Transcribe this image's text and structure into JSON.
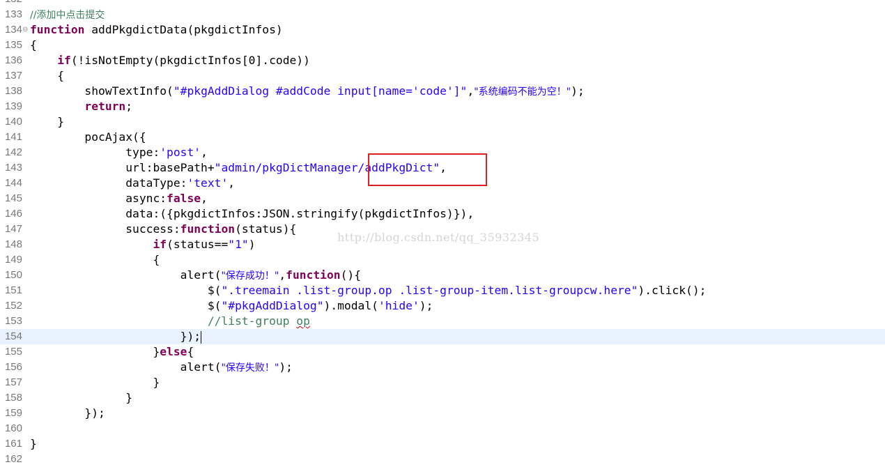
{
  "editor": {
    "watermark": "http://blog.csdn.net/qq_35932345",
    "colors": {
      "keyword": "#7f0055",
      "string": "#2a00ff",
      "comment": "#3f7f5f",
      "highlight": "#e02020",
      "current_line": "#e8f2fe"
    },
    "lines": [
      {
        "n": "132",
        "tokens": []
      },
      {
        "n": "133",
        "tokens": [
          {
            "t": "//添加中点击提交",
            "c": "cm"
          }
        ]
      },
      {
        "n": "134",
        "fold": true,
        "tokens": [
          {
            "t": "function",
            "c": "kw"
          },
          {
            "t": " addPkgdictData(pkgdictInfos)"
          }
        ]
      },
      {
        "n": "135",
        "tokens": [
          {
            "t": "{"
          }
        ]
      },
      {
        "n": "136",
        "tokens": [
          {
            "t": "    "
          },
          {
            "t": "if",
            "c": "kw"
          },
          {
            "t": "(!isNotEmpty(pkgdictInfos[0].code))"
          }
        ]
      },
      {
        "n": "137",
        "tokens": [
          {
            "t": "    {"
          }
        ]
      },
      {
        "n": "138",
        "tokens": [
          {
            "t": "        showTextInfo("
          },
          {
            "t": "\"#pkgAddDialog #addCode input[name='code']\"",
            "c": "str"
          },
          {
            "t": ","
          },
          {
            "t": "\"系统编码不能为空！\"",
            "c": "str"
          },
          {
            "t": ");"
          }
        ]
      },
      {
        "n": "139",
        "tokens": [
          {
            "t": "        "
          },
          {
            "t": "return",
            "c": "kw"
          },
          {
            "t": ";"
          }
        ]
      },
      {
        "n": "140",
        "tokens": [
          {
            "t": "    }"
          }
        ]
      },
      {
        "n": "141",
        "tokens": [
          {
            "t": "        pocAjax({"
          }
        ]
      },
      {
        "n": "142",
        "tokens": [
          {
            "t": "              type:"
          },
          {
            "t": "'post'",
            "c": "str"
          },
          {
            "t": ","
          }
        ]
      },
      {
        "n": "143",
        "tokens": [
          {
            "t": "              url:basePath+"
          },
          {
            "t": "\"admin/pkgDictManager/addPkgDict\"",
            "c": "str"
          },
          {
            "t": ","
          }
        ]
      },
      {
        "n": "144",
        "tokens": [
          {
            "t": "              dataType:"
          },
          {
            "t": "'text'",
            "c": "str"
          },
          {
            "t": ","
          }
        ]
      },
      {
        "n": "145",
        "tokens": [
          {
            "t": "              async:"
          },
          {
            "t": "false",
            "c": "kw"
          },
          {
            "t": ","
          }
        ]
      },
      {
        "n": "146",
        "tokens": [
          {
            "t": "              data:({pkgdictInfos:JSON.stringify(pkgdictInfos)}),"
          }
        ]
      },
      {
        "n": "147",
        "tokens": [
          {
            "t": "              success:"
          },
          {
            "t": "function",
            "c": "kw"
          },
          {
            "t": "(status){"
          }
        ]
      },
      {
        "n": "148",
        "tokens": [
          {
            "t": "                  "
          },
          {
            "t": "if",
            "c": "kw"
          },
          {
            "t": "(status=="
          },
          {
            "t": "\"1\"",
            "c": "str"
          },
          {
            "t": ")"
          }
        ]
      },
      {
        "n": "149",
        "tokens": [
          {
            "t": "                  {"
          }
        ]
      },
      {
        "n": "150",
        "tokens": [
          {
            "t": "                      alert("
          },
          {
            "t": "\"保存成功！\"",
            "c": "str"
          },
          {
            "t": ","
          },
          {
            "t": "function",
            "c": "kw"
          },
          {
            "t": "(){"
          }
        ]
      },
      {
        "n": "151",
        "tokens": [
          {
            "t": "                          $("
          },
          {
            "t": "\".treemain .list-group.op .list-group-item.list-groupcw.here\"",
            "c": "str"
          },
          {
            "t": ").click();"
          }
        ]
      },
      {
        "n": "152",
        "tokens": [
          {
            "t": "                          $("
          },
          {
            "t": "\"#pkgAddDialog\"",
            "c": "str"
          },
          {
            "t": ").modal("
          },
          {
            "t": "'hide'",
            "c": "str"
          },
          {
            "t": ");"
          }
        ]
      },
      {
        "n": "153",
        "tokens": [
          {
            "t": "                          "
          },
          {
            "t": "//list-group ",
            "c": "cm"
          },
          {
            "t": "op",
            "c": "cm sq"
          }
        ]
      },
      {
        "n": "154",
        "current": true,
        "caret": true,
        "tokens": [
          {
            "t": "                      });"
          }
        ]
      },
      {
        "n": "155",
        "tokens": [
          {
            "t": "                  }"
          },
          {
            "t": "else",
            "c": "kw"
          },
          {
            "t": "{"
          }
        ]
      },
      {
        "n": "156",
        "tokens": [
          {
            "t": "                      alert("
          },
          {
            "t": "\"保存失败！\"",
            "c": "str"
          },
          {
            "t": ");"
          }
        ]
      },
      {
        "n": "157",
        "tokens": [
          {
            "t": "                  }"
          }
        ]
      },
      {
        "n": "158",
        "tokens": [
          {
            "t": "              }"
          }
        ]
      },
      {
        "n": "159",
        "tokens": [
          {
            "t": "        });"
          }
        ]
      },
      {
        "n": "160",
        "tokens": []
      },
      {
        "n": "161",
        "tokens": [
          {
            "t": "}"
          }
        ]
      },
      {
        "n": "162",
        "tokens": []
      }
    ]
  }
}
